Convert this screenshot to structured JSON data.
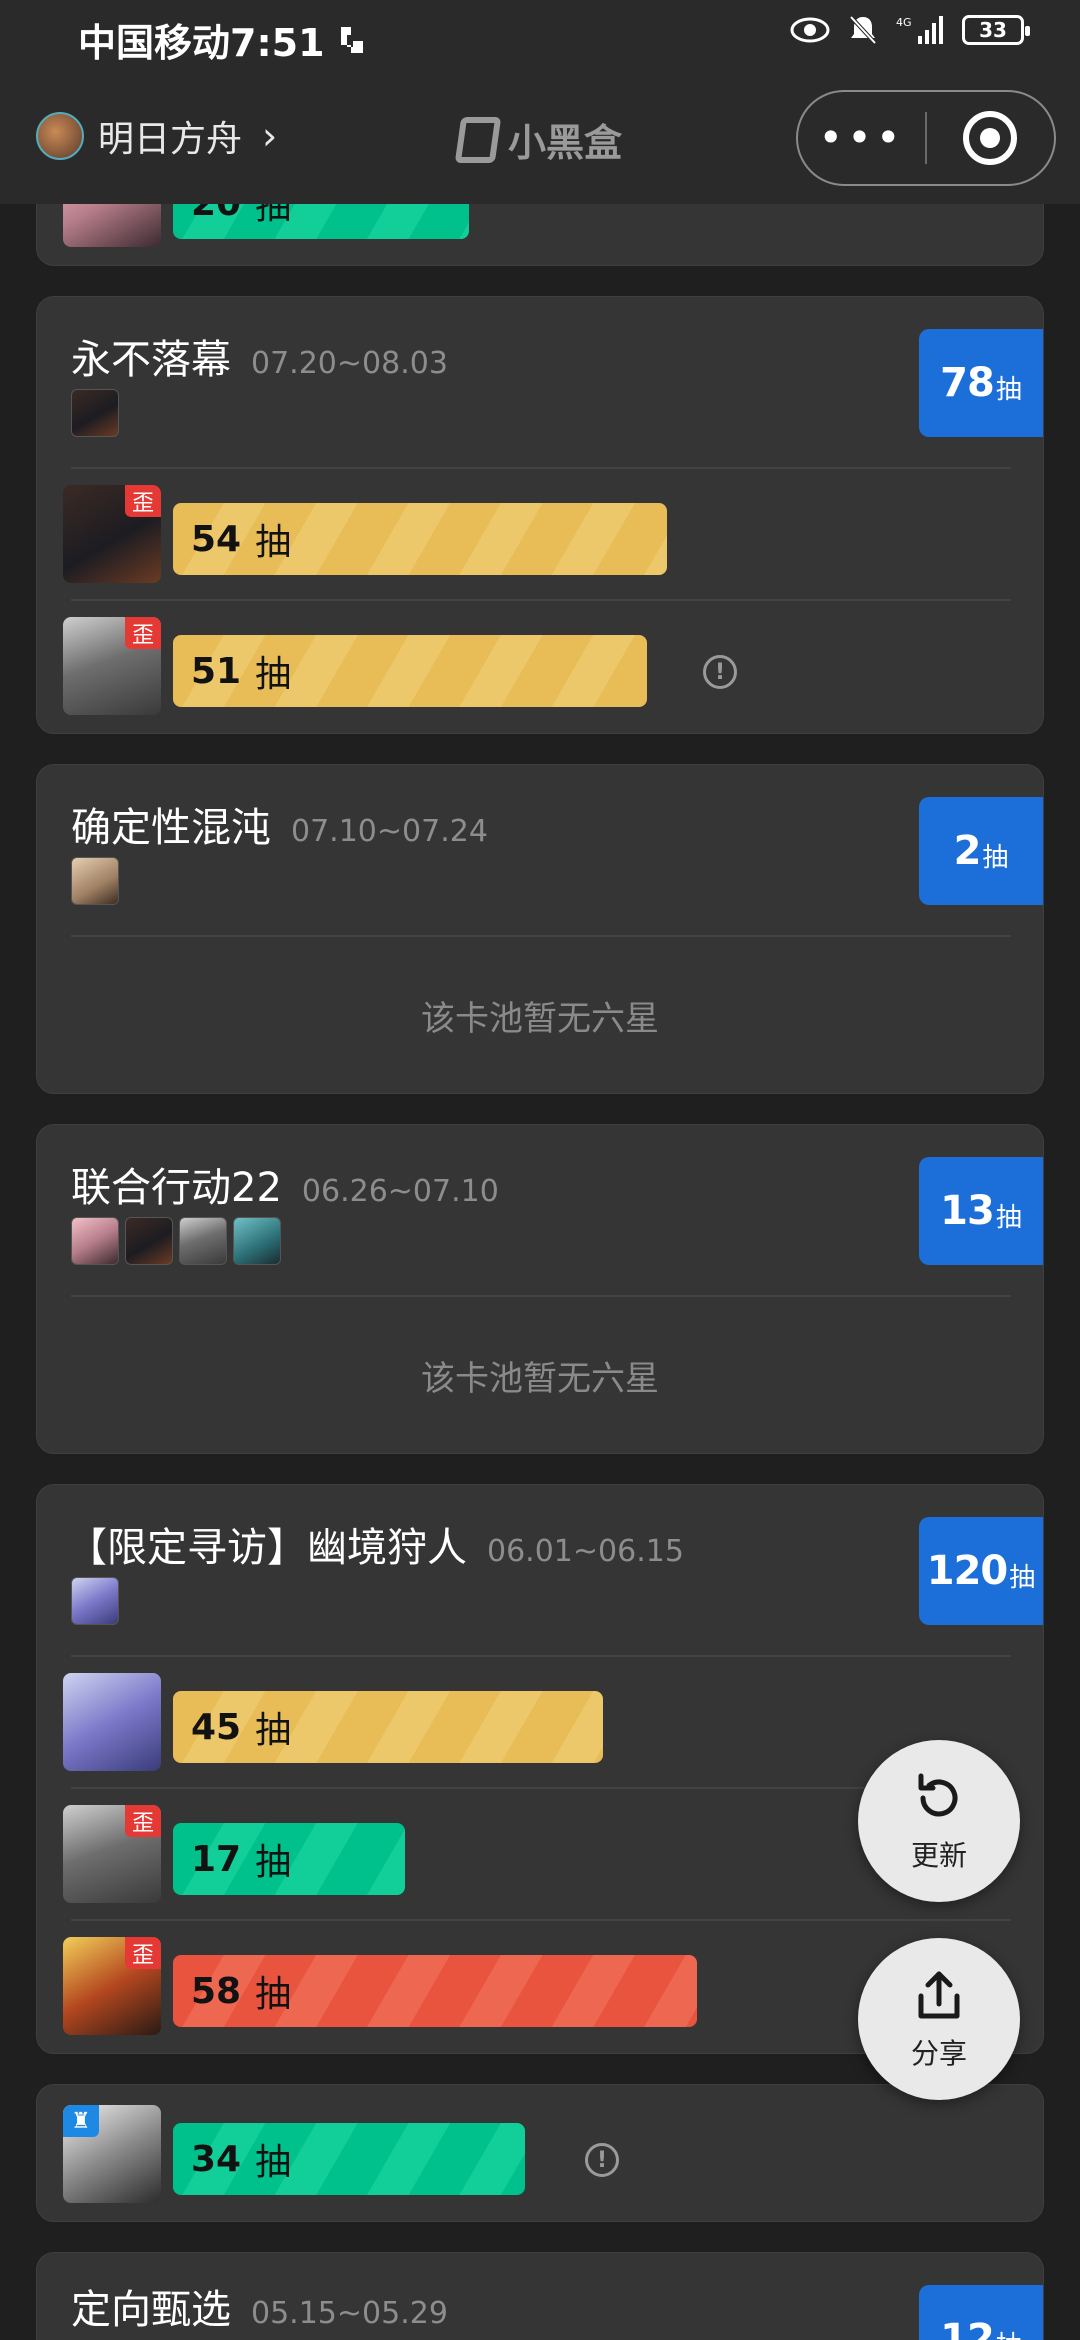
{
  "status_bar": {
    "carrier_time": "中国移动7:51",
    "battery": "33",
    "network": "4G"
  },
  "header": {
    "app_name": "明日方舟",
    "logo_text": "小黑盒"
  },
  "unit": "抽",
  "partial_top": {
    "count": "20"
  },
  "banners": [
    {
      "title": "永不落幕",
      "date": "07.20~08.03",
      "count": "78",
      "rows": [
        {
          "pulls": "54",
          "tag": "歪",
          "color": "yellow"
        },
        {
          "pulls": "51",
          "tag": "歪",
          "color": "yellow",
          "info": true
        }
      ]
    },
    {
      "title": "确定性混沌",
      "date": "07.10~07.24",
      "count": "2",
      "empty_text": "该卡池暂无六星"
    },
    {
      "title": "联合行动22",
      "date": "06.26~07.10",
      "count": "13",
      "empty_text": "该卡池暂无六星"
    },
    {
      "title": "【限定寻访】幽境狩人",
      "date": "06.01~06.15",
      "count": "120",
      "rows": [
        {
          "pulls": "45",
          "color": "yellow"
        },
        {
          "pulls": "17",
          "tag": "歪",
          "color": "green"
        },
        {
          "pulls": "58",
          "tag": "歪",
          "color": "red"
        }
      ]
    },
    {
      "title": "定向甄选",
      "date": "05.15~05.29",
      "count": "12"
    }
  ],
  "standalone_row": {
    "pulls": "34",
    "tag": "♜",
    "color": "green",
    "info": true
  },
  "fab": {
    "refresh_label": "更新",
    "share_label": "分享"
  },
  "info_glyph": "!"
}
